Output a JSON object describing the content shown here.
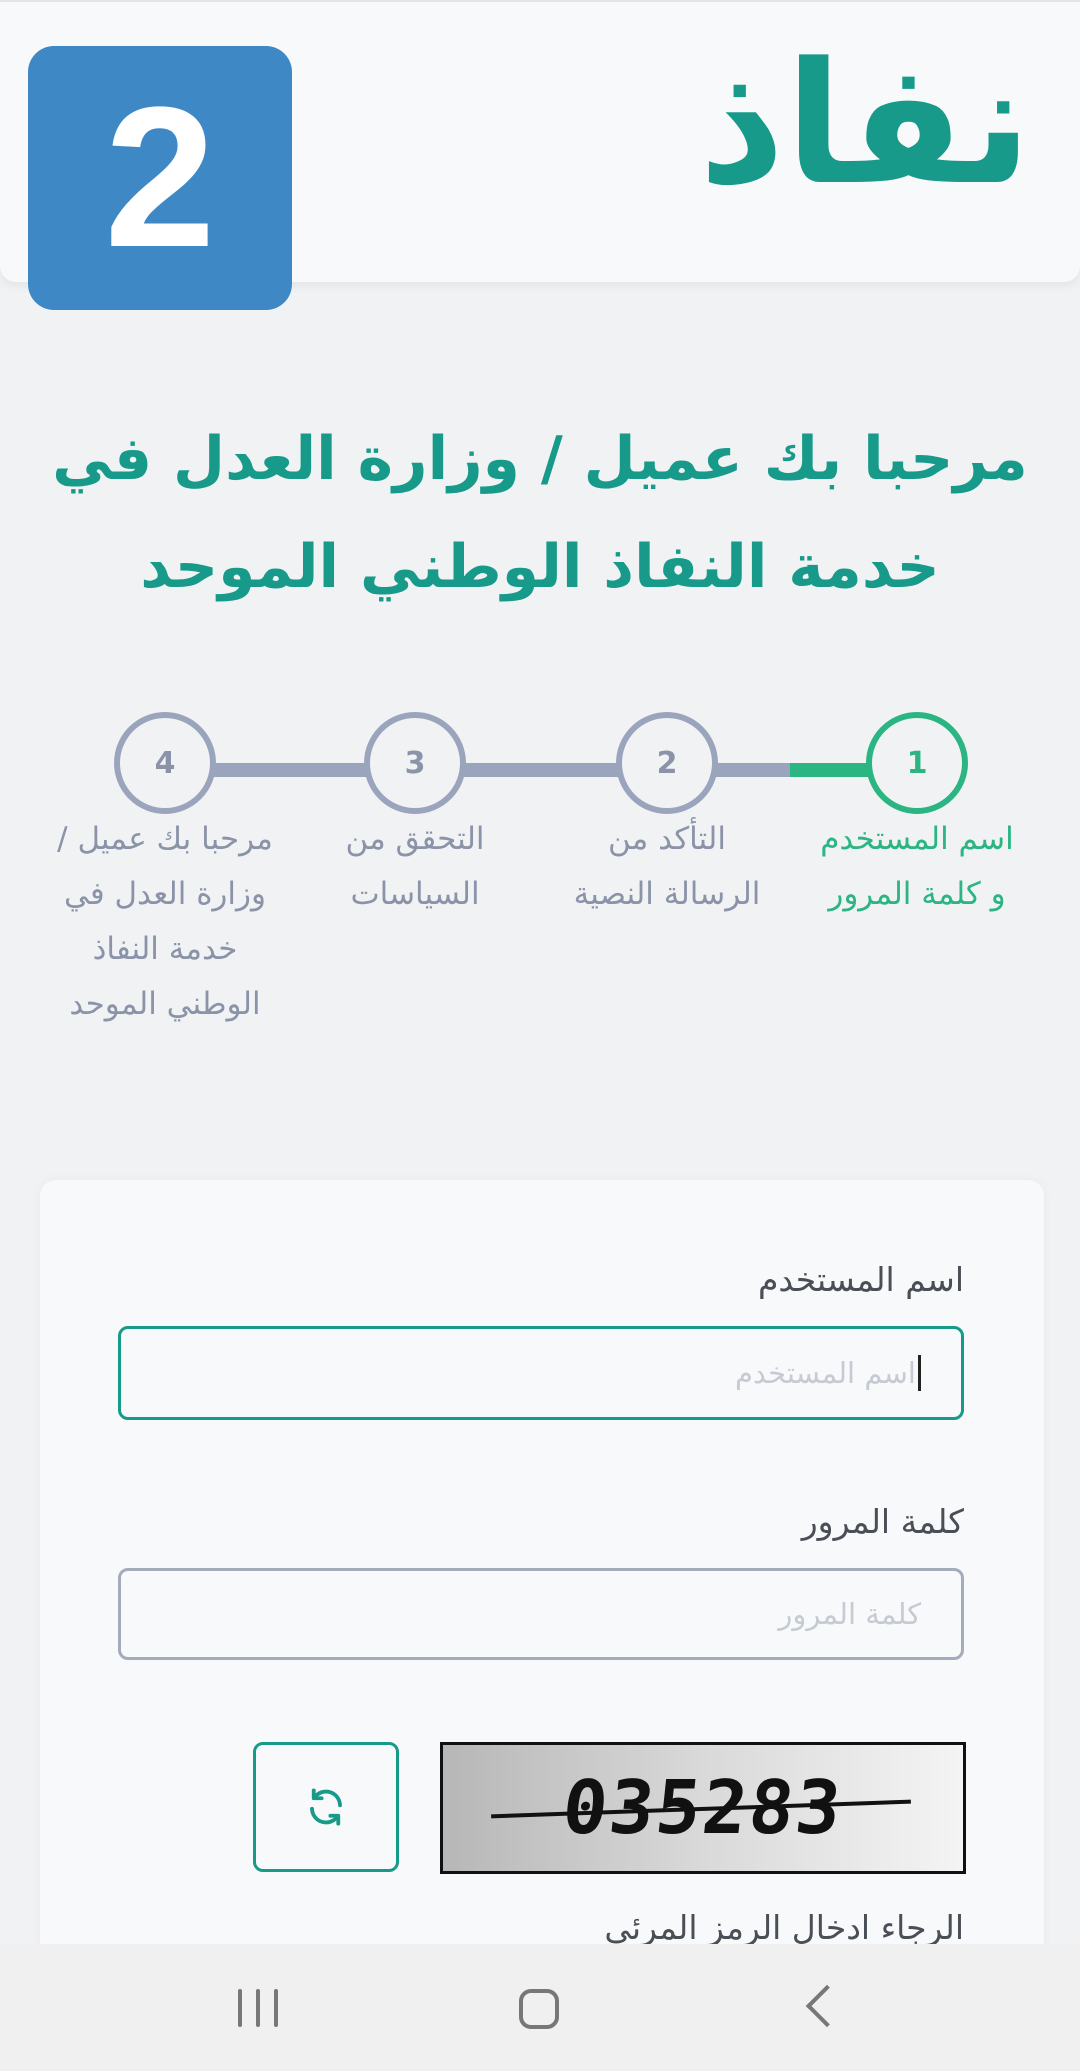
{
  "header": {
    "logo_text": "نفاذ",
    "badge_number": "2"
  },
  "welcome": {
    "line1": "مرحبا بك عميل / وزارة العدل في",
    "line2": "خدمة النفاذ الوطني الموحد"
  },
  "stepper": {
    "steps": [
      {
        "number": "1",
        "line1": "اسم المستخدم",
        "line2": "و كلمة المرور",
        "active": true
      },
      {
        "number": "2",
        "line1": "التأكد من",
        "line2": "الرسالة النصية",
        "active": false
      },
      {
        "number": "3",
        "line1": "التحقق من",
        "line2": "السياسات",
        "active": false
      },
      {
        "number": "4",
        "line1": "مرحبا بك عميل /",
        "line2": "وزارة العدل في",
        "line3": "خدمة النفاذ",
        "line4": "الوطني الموحد",
        "active": false
      }
    ]
  },
  "form": {
    "username_label": "اسم المستخدم",
    "username_placeholder": "اسم المستخدم",
    "password_label": "كلمة المرور",
    "password_placeholder": "كلمة المرور",
    "captcha_text": "035283",
    "captcha_hint": "الرجاء ادخال الرمز المرئي"
  },
  "colors": {
    "brand": "#179a8a",
    "badge": "#3d88c5",
    "step_active": "#2ab583",
    "step_inactive": "#9aa5bd"
  },
  "icons": {
    "refresh": "refresh-icon",
    "nav_recent": "recent-apps-icon",
    "nav_home": "home-icon",
    "nav_back": "back-icon"
  }
}
